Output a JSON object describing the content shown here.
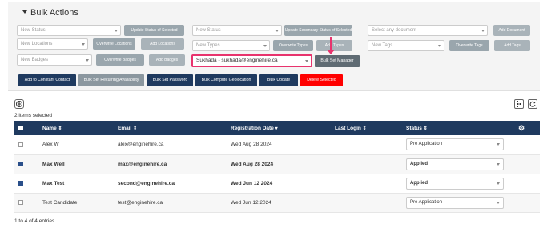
{
  "title": "Bulk Actions",
  "row1": {
    "new_status_ph": "New Status",
    "update_status_btn": "Update Status of Selected",
    "new_status2_ph": "New Status",
    "update_secondary_btn": "Update Secondary Status of Selected",
    "document_ph": "Select any document",
    "add_document_btn": "Add Document"
  },
  "row2": {
    "new_locations_ph": "New Locations",
    "overwrite_locations_btn": "Overwrite Locations",
    "add_locations_btn": "Add Locations",
    "new_types_ph": "New Types",
    "overwrite_types_btn": "Overwrite Types",
    "add_types_btn": "Add Types",
    "new_tags_ph": "New Tags",
    "overwrite_tags_btn": "Overwrite Tags",
    "add_tags_btn": "Add Tags"
  },
  "row3": {
    "new_badges_ph": "New Badges",
    "overwrite_badges_btn": "Overwrite Badges",
    "add_badges_btn": "Add Badges",
    "manager_value": "Sukhada - sukhada@enginehire.ca",
    "bulk_set_manager_btn": "Bulk Set Manager"
  },
  "row4": {
    "add_constant_contact": "Add to Constant Contact",
    "bulk_set_recurring": "Bulk Set Recurring Availability",
    "bulk_set_password": "Bulk Set Password",
    "bulk_compute_geo": "Bulk Compute Geolocation",
    "bulk_update": "Bulk Update",
    "delete_selected": "Delete Selected"
  },
  "selected_text": "2 items selected",
  "table": {
    "headers": {
      "name": "Name",
      "email": "Email",
      "registration_date": "Registration Date",
      "last_login": "Last Login",
      "status": "Status"
    },
    "rows": [
      {
        "name": "Alex W",
        "email": "alex@enginehire.ca",
        "date": "Wed Aug 28 2024",
        "last_login": "",
        "status": "Pre Application",
        "checked": false
      },
      {
        "name": "Max Well",
        "email": "max@enginehire.ca",
        "date": "Wed Aug 28 2024",
        "last_login": "",
        "status": "Applied",
        "checked": true
      },
      {
        "name": "Max Test",
        "email": "second@enginehire.ca",
        "date": "Wed Jun 12 2024",
        "last_login": "",
        "status": "Applied",
        "checked": true
      },
      {
        "name": "Test Candidate",
        "email": "test@enginehire.ca",
        "date": "Wed Jun 12 2024",
        "last_login": "",
        "status": "Pre Application",
        "checked": false
      }
    ]
  },
  "footer_text": "1 to 4 of 4 entries",
  "colors": {
    "header_bg": "#1f3a5f",
    "highlight": "#e8336d",
    "delete_btn": "#ff0000"
  }
}
